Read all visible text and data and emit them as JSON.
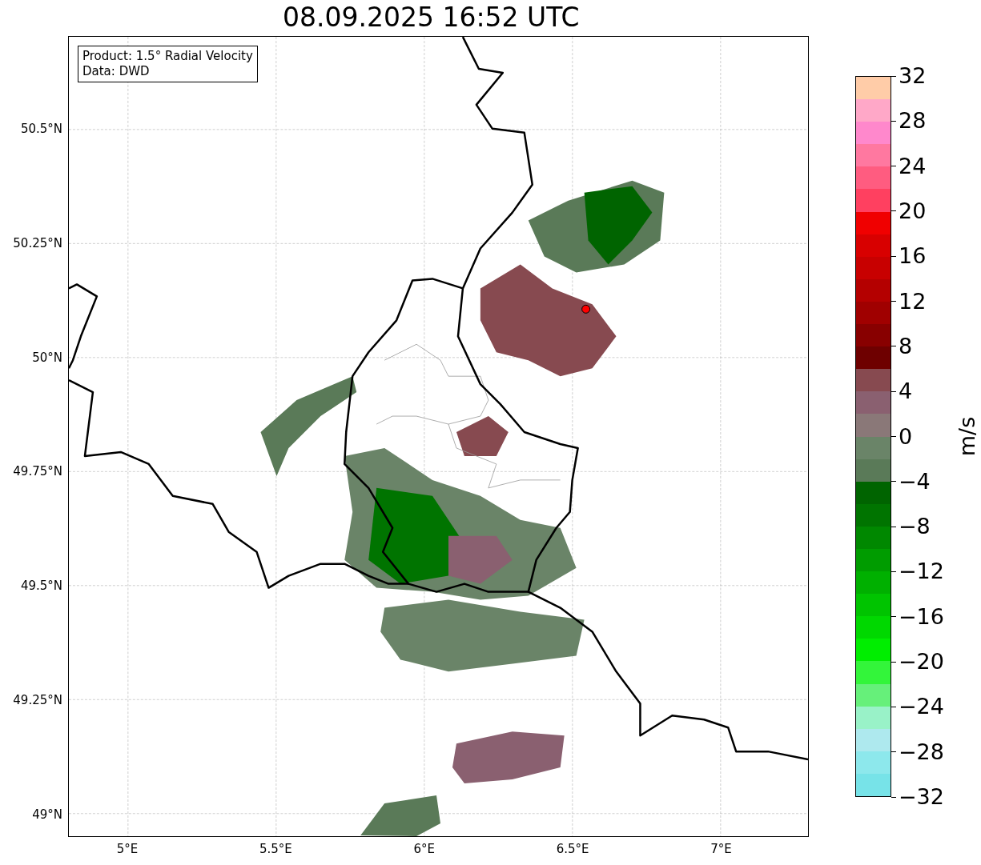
{
  "title": "08.09.2025 16:52 UTC",
  "info_box": [
    "Product: 1.5° Radial Velocity",
    "Data: DWD"
  ],
  "y_ticks": [
    "50.5°N",
    "50.25°N",
    "50°N",
    "49.75°N",
    "49.5°N",
    "49.25°N",
    "49°N"
  ],
  "x_ticks": [
    "5°E",
    "5.5°E",
    "6°E",
    "6.5°E",
    "7°E"
  ],
  "colorbar": {
    "label": "m/s",
    "ticks": [
      "32",
      "28",
      "24",
      "20",
      "16",
      "12",
      "8",
      "4",
      "0",
      "−4",
      "−8",
      "−12",
      "−16",
      "−20",
      "−24",
      "−28",
      "−32"
    ],
    "bands": [
      {
        "color": "#77e3e8"
      },
      {
        "color": "#8de8ec"
      },
      {
        "color": "#aee9ee"
      },
      {
        "color": "#99f2c8"
      },
      {
        "color": "#66f07a"
      },
      {
        "color": "#33f53a"
      },
      {
        "color": "#00ee00"
      },
      {
        "color": "#00d800"
      },
      {
        "color": "#00c400"
      },
      {
        "color": "#00b000"
      },
      {
        "color": "#009c00"
      },
      {
        "color": "#008800"
      },
      {
        "color": "#007400"
      },
      {
        "color": "#006400"
      },
      {
        "color": "#5a7a58"
      },
      {
        "color": "#6a8468"
      },
      {
        "color": "#8a7878"
      },
      {
        "color": "#8a6070"
      },
      {
        "color": "#874a50"
      },
      {
        "color": "#6e0000"
      },
      {
        "color": "#880000"
      },
      {
        "color": "#a00000"
      },
      {
        "color": "#b40000"
      },
      {
        "color": "#c80000"
      },
      {
        "color": "#d80000"
      },
      {
        "color": "#f00000"
      },
      {
        "color": "#ff4060"
      },
      {
        "color": "#ff5c80"
      },
      {
        "color": "#ff78a0"
      },
      {
        "color": "#ff88cc"
      },
      {
        "color": "#ffa8c8"
      },
      {
        "color": "#ffcca8"
      }
    ]
  }
}
